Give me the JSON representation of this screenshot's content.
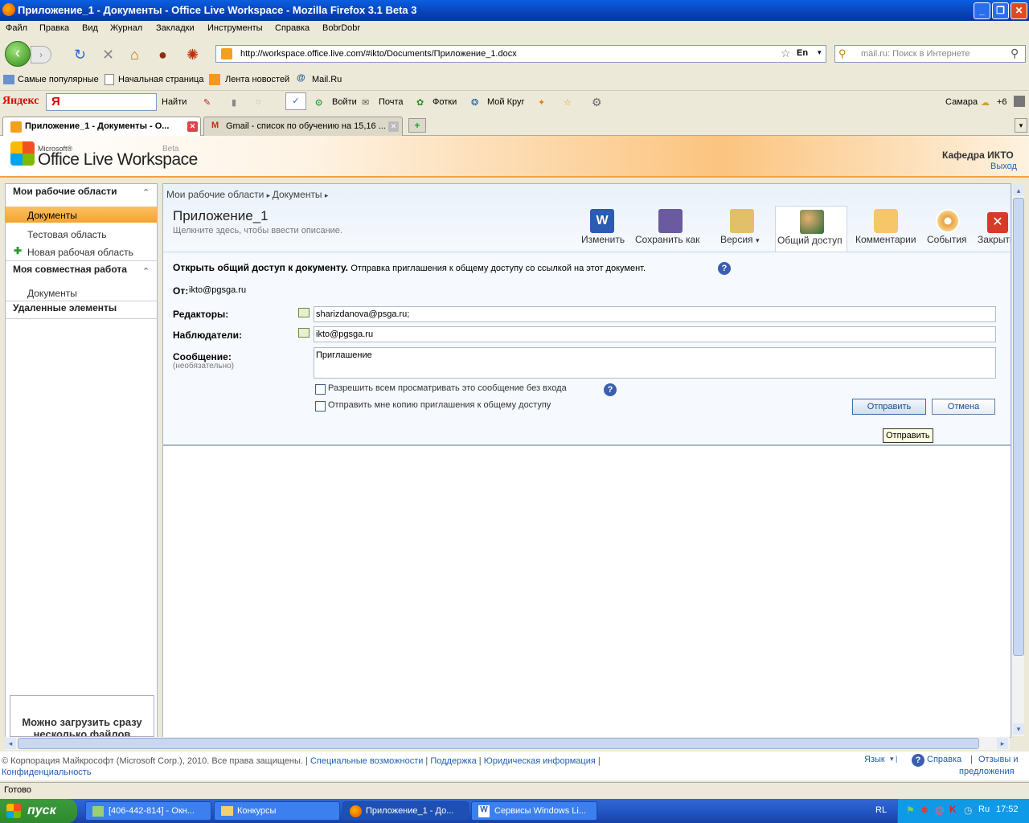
{
  "window": {
    "title": "Приложение_1 - Документы - Office Live Workspace - Mozilla Firefox 3.1 Beta 3"
  },
  "menu": [
    "Файл",
    "Правка",
    "Вид",
    "Журнал",
    "Закладки",
    "Инструменты",
    "Справка",
    "BobrDobr"
  ],
  "nav": {
    "url": "http://workspace.office.live.com/#ikto/Documents/Приложение_1.docx",
    "lang": "En",
    "search_placeholder": "mail.ru: Поиск в Интернете"
  },
  "bookmarks": [
    "Самые популярные",
    "Начальная страница",
    "Лента новостей",
    "Mail.Ru"
  ],
  "yandex": {
    "brand": "Яндекс",
    "find": "Найти",
    "login": "Войти",
    "mail": "Почта",
    "photos": "Фотки",
    "circle": "Мой Круг",
    "city": "Самара",
    "temp": "+6"
  },
  "tabs": [
    {
      "label": "Приложение_1 - Документы - О..."
    },
    {
      "label": "Gmail - список по обучению на 15,16 ..."
    }
  ],
  "banner": {
    "ms": "Microsoft®",
    "product": "Office Live Workspace",
    "beta": "Beta",
    "org": "Кафедра ИКТО",
    "logout": "Выход"
  },
  "sidebar": {
    "h1": "Мои рабочие области",
    "items1": [
      "Документы",
      "Тестовая область",
      "Новая рабочая область"
    ],
    "h2": "Моя совместная работа",
    "items2": [
      "Документы"
    ],
    "h3": "Удаленные элементы",
    "promo": "Можно загрузить сразу несколько файлов"
  },
  "breadcrumb": [
    "Мои рабочие области",
    "Документы"
  ],
  "doc": {
    "title": "Приложение_1",
    "desc": "Щелкните здесь, чтобы ввести описание."
  },
  "tools": [
    "Изменить",
    "Сохранить как",
    "Версия",
    "Общий доступ",
    "Комментарии",
    "События",
    "Закрыть"
  ],
  "share": {
    "heading": "Открыть общий доступ к документу.",
    "heading_desc": "Отправка приглашения к общему доступу со ссылкой на этот документ.",
    "from_label": "От:",
    "from": "ikto@pgsga.ru",
    "editors_label": "Редакторы:",
    "editors": "sharizdanova@psga.ru;",
    "viewers_label": "Наблюдатели:",
    "viewers": "ikto@pgsga.ru",
    "message_label": "Сообщение:",
    "message_hint": "(необязательно)",
    "message": "Приглашение",
    "opt1": "Разрешить всем просматривать это сообщение без входа",
    "opt2": "Отправить мне копию приглашения к общему доступу",
    "send": "Отправить",
    "cancel": "Отмена",
    "tooltip": "Отправить"
  },
  "footer": {
    "copyright": "© Корпорация Майкрософт (Microsoft Corp.), 2010. Все права защищены.",
    "links": [
      "Специальные возможности",
      "Поддержка",
      "Юридическая информация",
      "Конфиденциальность"
    ],
    "lang": "Язык",
    "help": "Справка",
    "feedback1": "Отзывы и",
    "feedback2": "предложения"
  },
  "status": "Готово",
  "taskbar": {
    "start": "пуск",
    "items": [
      "[406-442-814] - Окн...",
      "Конкурсы",
      "Приложение_1 - До...",
      "Сервисы Windows Li..."
    ],
    "lang": "RL",
    "tray_lang": "Ru",
    "clock": "17:52"
  }
}
